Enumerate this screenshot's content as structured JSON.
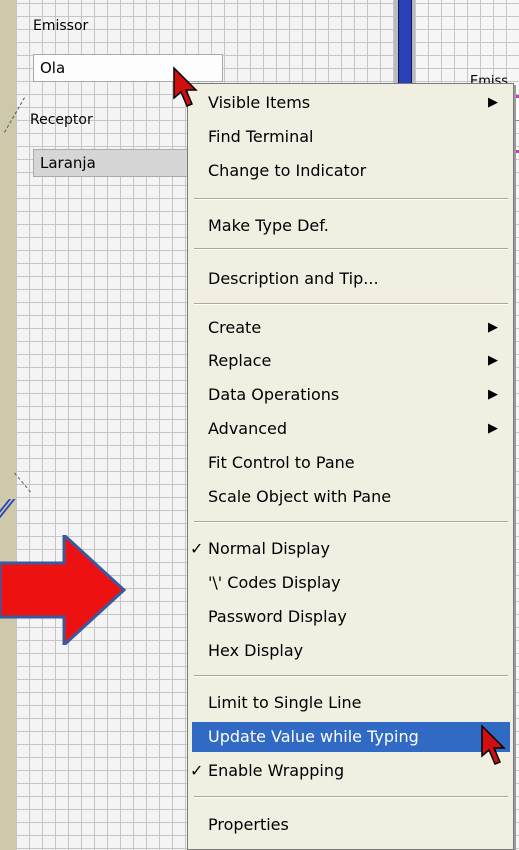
{
  "front_panel": {
    "emissor_label": "Emissor",
    "emissor_value": "Ola",
    "receptor_label": "Receptor",
    "receptor_value": "Laranja",
    "right_label": "Emiss"
  },
  "context_menu": {
    "items": [
      {
        "label": "Visible Items",
        "submenu": true
      },
      {
        "label": "Find Terminal"
      },
      {
        "label": "Change to Indicator"
      },
      {
        "label": "Make Type Def."
      },
      {
        "label": "Description and Tip..."
      },
      {
        "label": "Create",
        "submenu": true
      },
      {
        "label": "Replace",
        "submenu": true
      },
      {
        "label": "Data Operations",
        "submenu": true
      },
      {
        "label": "Advanced",
        "submenu": true
      },
      {
        "label": "Fit Control to Pane"
      },
      {
        "label": "Scale Object with Pane"
      },
      {
        "label": "Normal Display",
        "checked": true
      },
      {
        "label": "'\\' Codes Display"
      },
      {
        "label": "Password Display"
      },
      {
        "label": "Hex Display"
      },
      {
        "label": "Limit to Single Line"
      },
      {
        "label": "Update Value while Typing",
        "highlighted": true
      },
      {
        "label": "Enable Wrapping",
        "checked": true
      },
      {
        "label": "Properties"
      }
    ],
    "submenu_glyph": "▶",
    "check_glyph": "✓"
  },
  "colors": {
    "highlight": "#316ac5",
    "arrow_fill": "#ee1111",
    "arrow_stroke": "#3a5aa0",
    "cursor": "#d01010"
  }
}
